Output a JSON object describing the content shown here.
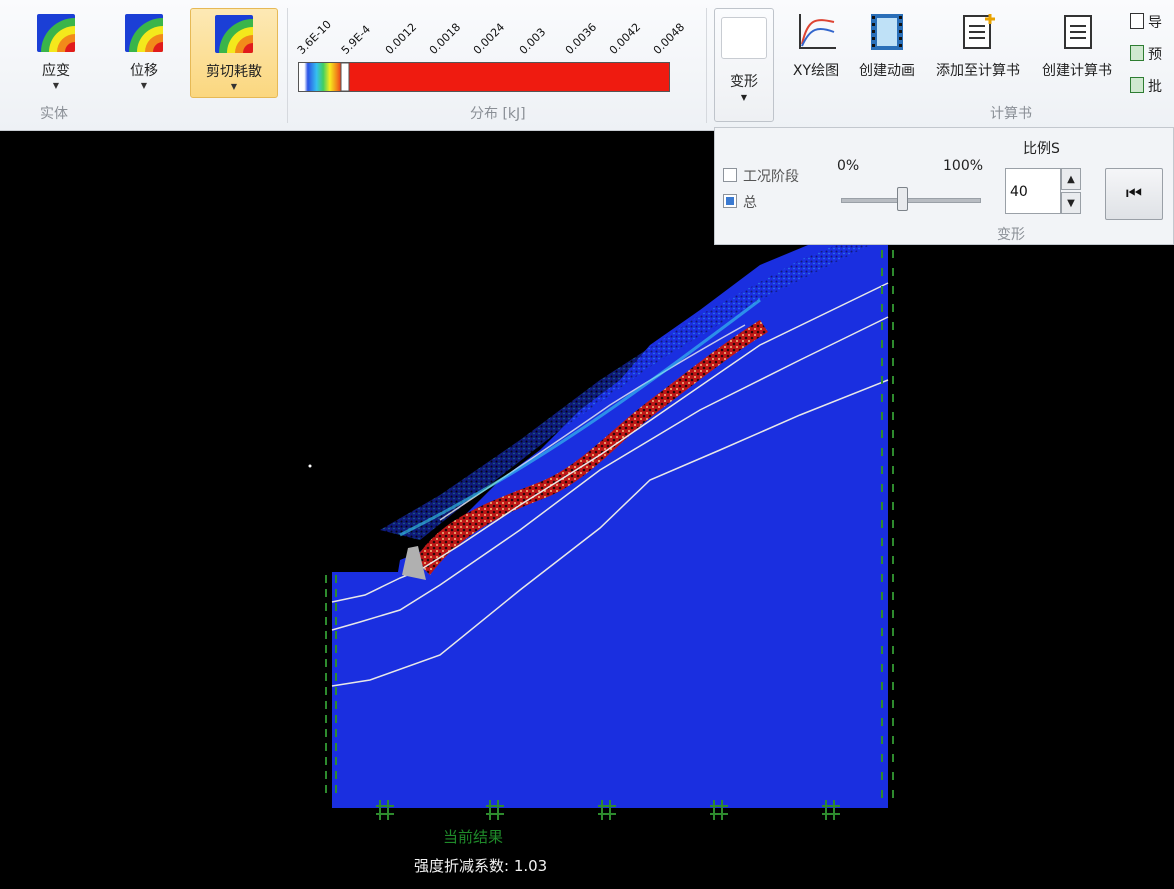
{
  "ribbon": {
    "solid_group": {
      "label": "实体",
      "buttons": [
        {
          "label": "应变",
          "active": false
        },
        {
          "label": "位移",
          "active": false
        },
        {
          "label": "剪切耗散",
          "active": true
        }
      ]
    },
    "distribution_group": {
      "label": "分布 [kJ]",
      "ticks": [
        "3.6E-10",
        "5.9E-4",
        "0.0012",
        "0.0018",
        "0.0024",
        "0.003",
        "0.0036",
        "0.0042",
        "0.0048"
      ]
    },
    "deform_button": {
      "label": "变形"
    },
    "calc_group": {
      "label": "计算书",
      "tools": [
        {
          "label": "XY绘图",
          "icon": "xy-plot-icon"
        },
        {
          "label": "创建动画",
          "icon": "film-icon"
        },
        {
          "label": "添加至计算书",
          "icon": "doc-add-icon"
        },
        {
          "label": "创建计算书",
          "icon": "doc-icon"
        }
      ],
      "side_items": [
        "导",
        "预",
        "批"
      ]
    }
  },
  "deform_panel": {
    "label": "变形",
    "checkbox_stage": {
      "label": "工况阶段",
      "checked": false
    },
    "checkbox_total": {
      "label": "总",
      "checked": true
    },
    "slider_min": "0%",
    "slider_max": "100%",
    "scale_label": "比例S",
    "scale_value": "40"
  },
  "canvas": {
    "status": "当前结果",
    "factor_label": "强度折减系数: 1.03"
  },
  "colors": {
    "soil": "#1a2fe0",
    "shear_band": "#d8151a",
    "legend_red": "#ef1b10",
    "caption_green": "#1f8a2a"
  }
}
